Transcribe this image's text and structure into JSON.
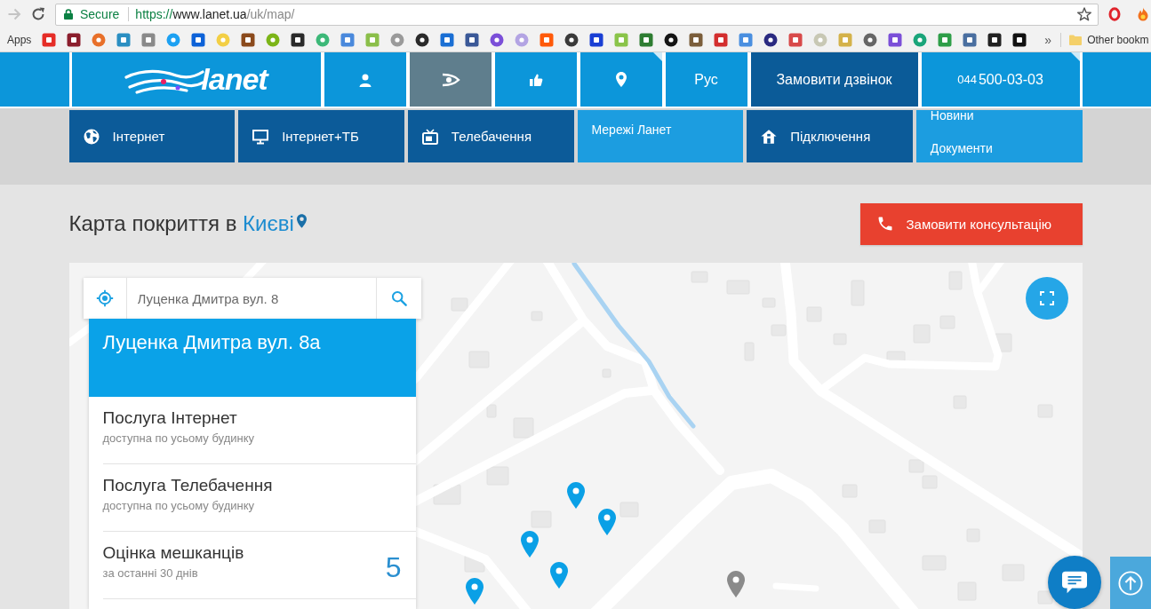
{
  "browser": {
    "forward": {
      "disabled": true
    },
    "secure_label": "Secure",
    "url": {
      "scheme": "https://",
      "host": "www.lanet.ua",
      "path": "/uk/map/"
    },
    "bookmarks": {
      "apps": "Apps",
      "more": "»",
      "other": "Other bookm"
    }
  },
  "site_header": {
    "logo": "lanet",
    "top_items": [
      {
        "kind": "icon",
        "selected": false,
        "dropdown": false
      },
      {
        "kind": "icon",
        "selected": true,
        "dropdown": false
      },
      {
        "kind": "icon",
        "selected": false,
        "dropdown": false
      },
      {
        "kind": "icon",
        "selected": false,
        "dropdown": true
      },
      {
        "kind": "text",
        "label": "Рус",
        "selected": false,
        "dropdown": false
      },
      {
        "kind": "call",
        "label": "Замовити дзвінок",
        "selected": false,
        "dropdown": false
      },
      {
        "kind": "phone",
        "code": "044",
        "number": "500-03-03",
        "selected": false,
        "dropdown": true
      }
    ],
    "menu": [
      {
        "kind": "icon",
        "label": "Інтернет"
      },
      {
        "kind": "icon",
        "label": "Інтернет+ТБ"
      },
      {
        "kind": "icon",
        "label": "Телебачення"
      },
      {
        "kind": "text",
        "label": "Мережі Ланет"
      },
      {
        "kind": "icon",
        "label": "Підключення"
      },
      {
        "kind": "links",
        "links": [
          "Новини",
          "Документи"
        ]
      }
    ]
  },
  "page": {
    "title": "Карта покриття в",
    "city": "Києві",
    "consult_button": "Замовити консультацію"
  },
  "map": {
    "search": {
      "value": "Луценка Дмитра вул. 8"
    },
    "card": {
      "address": "Луценка Дмитра вул. 8а",
      "rows": [
        {
          "title": "Послуга Інтернет",
          "subtitle": "доступна по усьому будинку"
        },
        {
          "title": "Послуга Телебачення",
          "subtitle": "доступна по усьому будинку"
        },
        {
          "title": "Оцінка мешканців",
          "subtitle": "за останні 30 днів",
          "value": "5"
        }
      ]
    },
    "markers": [
      {
        "color": "#0aa0e6"
      },
      {
        "color": "#0aa0e6"
      },
      {
        "color": "#0aa0e6"
      },
      {
        "color": "#0aa0e6"
      },
      {
        "color": "#0aa0e6"
      },
      {
        "color": "#8a8a8a"
      }
    ]
  }
}
